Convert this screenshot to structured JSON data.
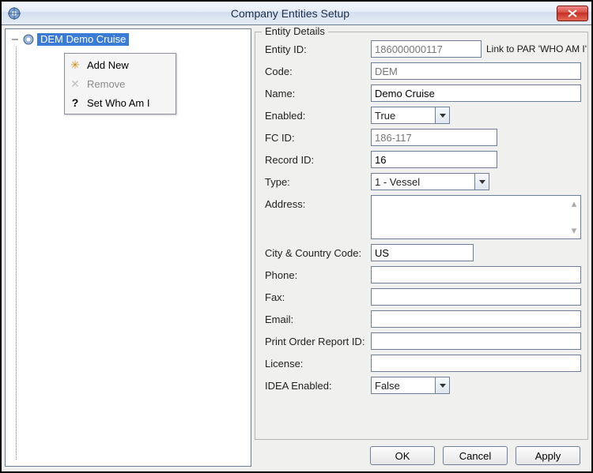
{
  "window": {
    "title": "Company Entities Setup",
    "close_tooltip": "Close"
  },
  "tree": {
    "node_label": "DEM  Demo Cruise"
  },
  "context_menu": {
    "add_new": "Add New",
    "remove": "Remove",
    "set_who_am_i": "Set Who Am I"
  },
  "group": {
    "title": "Entity Details"
  },
  "labels": {
    "entity_id": "Entity ID:",
    "code": "Code:",
    "name": "Name:",
    "enabled": "Enabled:",
    "fc_id": "FC ID:",
    "record_id": "Record ID:",
    "type": "Type:",
    "address": "Address:",
    "city_country": "City & Country Code:",
    "phone": "Phone:",
    "fax": "Fax:",
    "email": "Email:",
    "print_order_report_id": "Print Order Report ID:",
    "license": "License:",
    "idea_enabled": "IDEA Enabled:"
  },
  "values": {
    "entity_id": "186000000117",
    "link_par_text": "Link to PAR 'WHO AM I'",
    "code": "DEM",
    "name": "Demo Cruise",
    "enabled": "True",
    "fc_id": "186-117",
    "record_id": "16",
    "type": "1 - Vessel",
    "address": "",
    "city_country": "US",
    "phone": "",
    "fax": "",
    "email": "",
    "print_order_report_id": "",
    "license": "",
    "idea_enabled": "False"
  },
  "buttons": {
    "ok": "OK",
    "cancel": "Cancel",
    "apply": "Apply"
  }
}
